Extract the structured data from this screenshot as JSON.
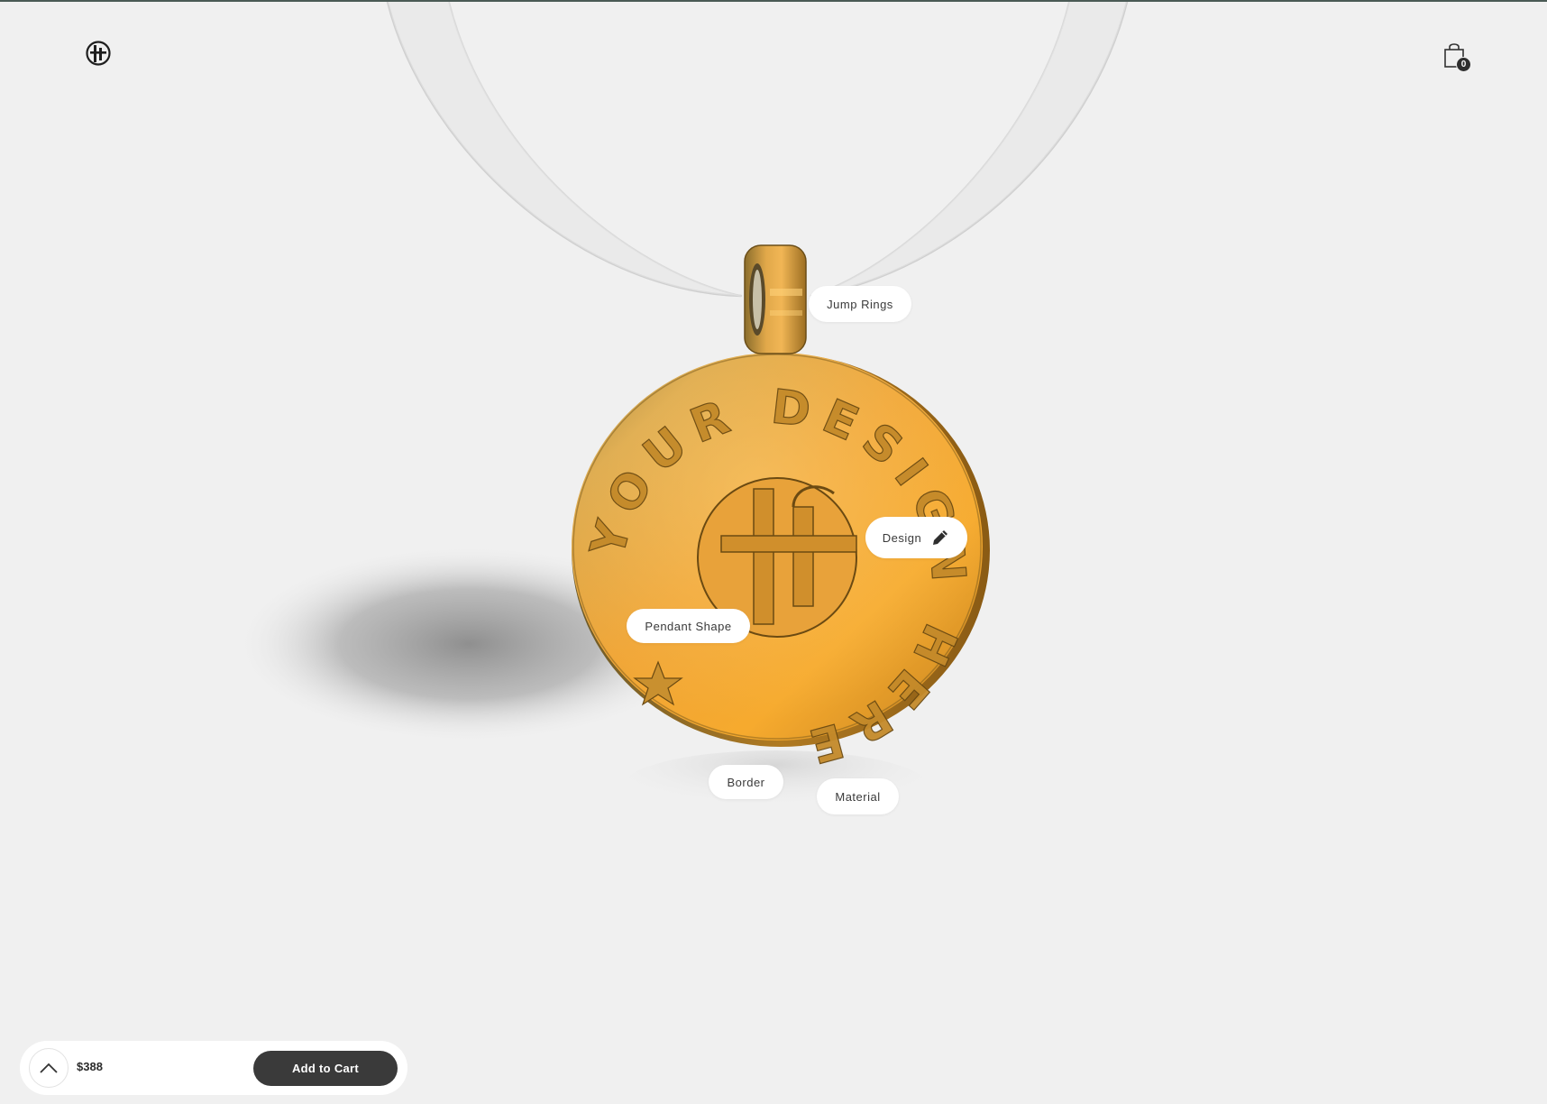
{
  "header": {
    "logo_icon": "brand-logo-icon",
    "cart_icon": "shopping-bag-icon",
    "cart_count": "0"
  },
  "pendant": {
    "engraved_text": "YOUR DESIGN HERE",
    "material_color": "#e0962e"
  },
  "hotspots": {
    "jump_rings": "Jump Rings",
    "design": "Design",
    "design_icon": "pencil-icon",
    "pendant_shape": "Pendant Shape",
    "border": "Border",
    "material": "Material"
  },
  "purchase_bar": {
    "expand_icon": "chevron-up-icon",
    "price": "$388",
    "add_to_cart_label": "Add to Cart"
  }
}
